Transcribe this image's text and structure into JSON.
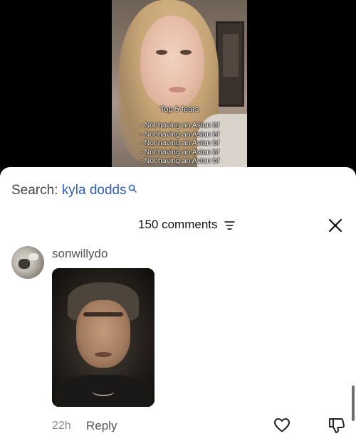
{
  "video": {
    "caption_title": "Top 5 fears",
    "caption_lines": [
      "- Not having an Asian bf",
      "- Not having an Asian bf",
      "- Not having an Asian bf",
      "- Not having an Asian bf",
      "- Not having an Asian bf"
    ]
  },
  "search": {
    "label": "Search:",
    "query": "kyla dodds",
    "icon": "search-icon"
  },
  "comments_header": {
    "count_label": "150 comments",
    "filter_icon": "filter-icon",
    "close_icon": "close-icon"
  },
  "comment": {
    "username": "sonwillydo",
    "time": "22h",
    "reply_label": "Reply",
    "like_icon": "heart-icon",
    "dislike_icon": "thumbs-down-icon"
  },
  "colors": {
    "search_query": "#2d5fb5",
    "secondary_text": "#8a8a8a",
    "sheet_bg": "#ffffff"
  }
}
